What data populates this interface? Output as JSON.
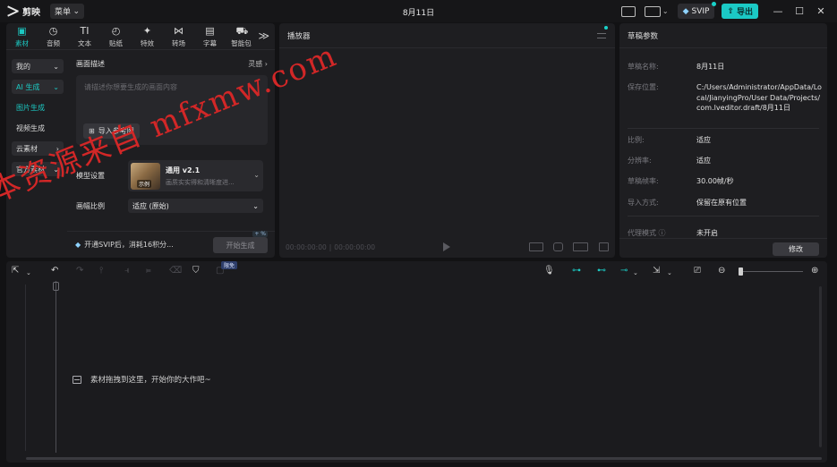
{
  "app": {
    "name": "剪映",
    "menu_label": "菜单",
    "window_title": "8月11日"
  },
  "titlebar": {
    "svip_label": "SVIP",
    "export_label": "导出",
    "minimize": "—",
    "maximize": "☐",
    "close": "✕"
  },
  "tools": [
    {
      "label": "素材",
      "icon": "media-icon",
      "glyph": "▣"
    },
    {
      "label": "音频",
      "icon": "audio-icon",
      "glyph": "◷"
    },
    {
      "label": "文本",
      "icon": "text-icon",
      "glyph": "TI"
    },
    {
      "label": "贴纸",
      "icon": "sticker-icon",
      "glyph": "◴"
    },
    {
      "label": "特效",
      "icon": "effects-icon",
      "glyph": "✦"
    },
    {
      "label": "转场",
      "icon": "transition-icon",
      "glyph": "⋈"
    },
    {
      "label": "字幕",
      "icon": "caption-icon",
      "glyph": "▤"
    },
    {
      "label": "智能包",
      "icon": "smart-pack-icon",
      "glyph": "⛟"
    }
  ],
  "tools_more": "≫",
  "sidebar": {
    "mine": "我的",
    "ai_gen": "AI 生成",
    "image_gen": "图片生成",
    "video_gen": "视频生成",
    "cloud": "云素材",
    "official": "官方素材"
  },
  "ai_panel": {
    "desc_label": "画面描述",
    "inspire": "灵感 ›",
    "placeholder": "请描述你想要生成的画面内容",
    "ref_button": "导入参考图",
    "model_label": "模型设置",
    "model_name": "通用 v2.1",
    "model_desc": "画质实实得和清晰度进...",
    "model_tag": "示例",
    "ratio_label": "画幅比例",
    "ratio_value": "适应 (原始)",
    "promo": "开通SVIP后，消耗16积分...",
    "generate": "开始生成",
    "generate_badge": "+ %"
  },
  "player": {
    "title": "播放器",
    "time_current": "00:00:00:00",
    "time_total": "00:00:00:00"
  },
  "draft": {
    "title": "草稿参数",
    "rows": [
      {
        "key": "草稿名称:",
        "value": "8月11日"
      },
      {
        "key": "保存位置:",
        "value": "C:/Users/Administrator/AppData/Local/JianyingPro/User Data/Projects/com.lveditor.draft/8月11日"
      },
      {
        "key": "比例:",
        "value": "适应"
      },
      {
        "key": "分辨率:",
        "value": "适应"
      },
      {
        "key": "草稿帧率:",
        "value": "30.00帧/秒"
      },
      {
        "key": "导入方式:",
        "value": "保留在原有位置"
      },
      {
        "key": "代理模式 ⓘ",
        "value": "未开启"
      }
    ],
    "edit_button": "修改"
  },
  "timeline": {
    "new_badge": "限免",
    "drop_hint": "素材拖拽到这里，开始你的大作吧~"
  },
  "watermark": "本资源来自 mfxmw.com",
  "colors": {
    "accent": "#1cc8c2",
    "export_bg": "#1bc9c5",
    "watermark": "#d22727"
  }
}
